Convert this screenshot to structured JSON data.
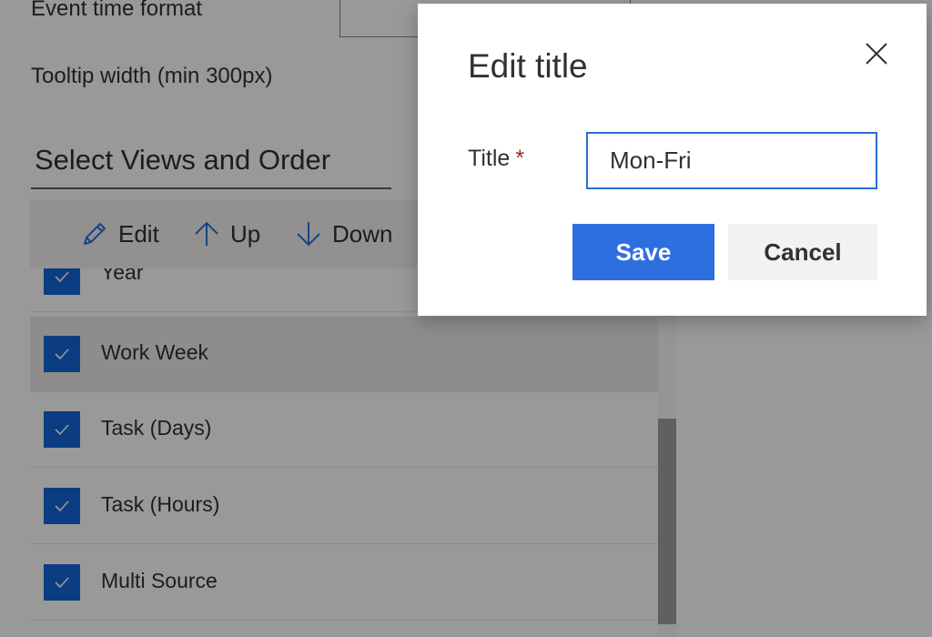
{
  "settings": {
    "event_time_format_label": "Event time format",
    "tooltip_width_label": "Tooltip width (min 300px)",
    "views_section_title": "Select Views and Order"
  },
  "toolbar": {
    "edit_label": "Edit",
    "up_label": "Up",
    "down_label": "Down"
  },
  "views": [
    {
      "label": "Year",
      "checked": true
    },
    {
      "label": "Work Week",
      "checked": true,
      "selected": true
    },
    {
      "label": "Task (Days)",
      "checked": true
    },
    {
      "label": "Task (Hours)",
      "checked": true
    },
    {
      "label": "Multi Source",
      "checked": true
    }
  ],
  "dialog": {
    "title": "Edit title",
    "field_label": "Title",
    "required_marker": "*",
    "field_value": "Mon-Fri",
    "save_label": "Save",
    "cancel_label": "Cancel"
  },
  "colors": {
    "accent": "#2e6fe0",
    "checkbox": "#1565d8",
    "required": "#a4262c"
  }
}
